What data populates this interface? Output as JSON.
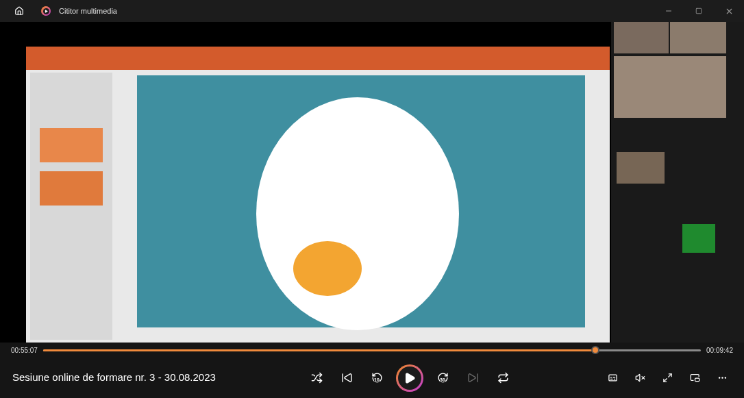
{
  "window": {
    "title": "Cititor multimedia"
  },
  "progress": {
    "elapsed": "00:55:07",
    "remaining": "00:09:42",
    "level": 0.84
  },
  "media_title": "Sesiune online de formare nr. 3 - 30.08.2023",
  "controls": [
    {
      "kind": "shuffle",
      "disabled": false
    },
    {
      "kind": "previous",
      "disabled": false
    },
    {
      "kind": "rewind",
      "label": "10",
      "disabled": false
    },
    {
      "kind": "play",
      "disabled": false
    },
    {
      "kind": "forward",
      "label": "30",
      "disabled": false
    },
    {
      "kind": "next",
      "disabled": true
    },
    {
      "kind": "repeat",
      "disabled": false
    }
  ],
  "right_controls": [
    {
      "kind": "subtitles"
    },
    {
      "kind": "mute"
    },
    {
      "kind": "fullscreen"
    },
    {
      "kind": "miniplayer"
    },
    {
      "kind": "more"
    }
  ]
}
